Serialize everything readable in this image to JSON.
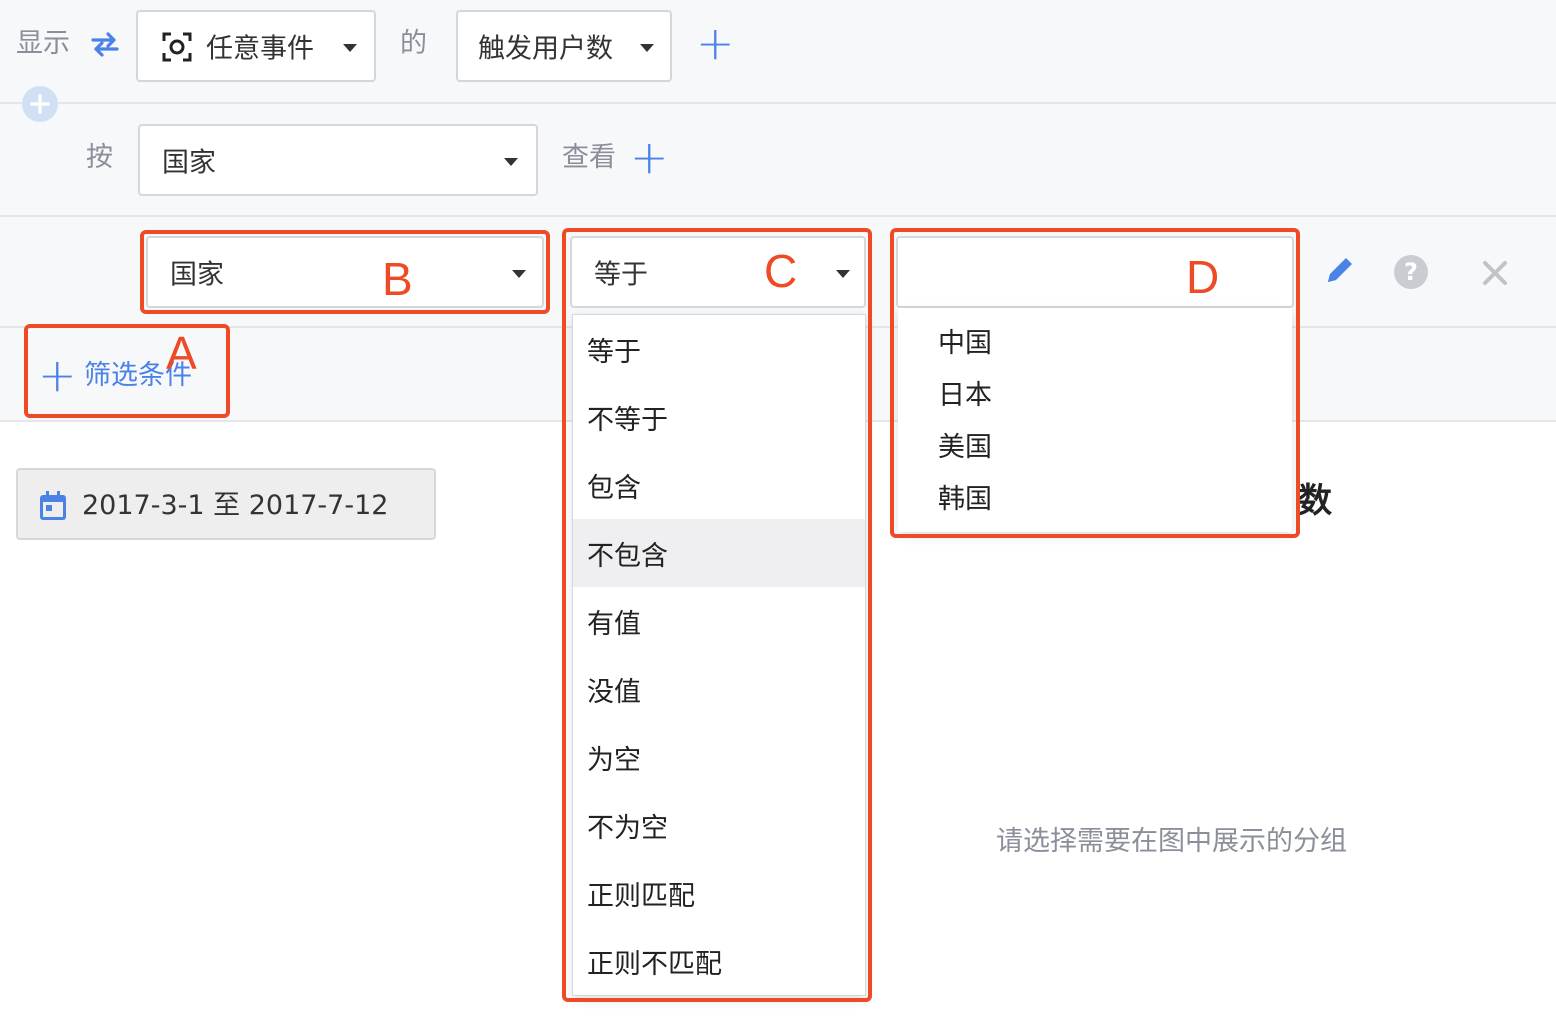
{
  "row1": {
    "show_label": "显示",
    "event_select": "任意事件",
    "of_label": "的",
    "metric_select": "触发用户数"
  },
  "row2": {
    "by_label": "按",
    "group_select": "国家",
    "view_label": "查看"
  },
  "filter": {
    "property_select": "国家",
    "operator_select": "等于",
    "value_input": "",
    "add_filter_label": "筛选条件"
  },
  "annotations": {
    "a": "A",
    "b": "B",
    "c": "C",
    "d": "D"
  },
  "operator_menu": {
    "items": [
      "等于",
      "不等于",
      "包含",
      "不包含",
      "有值",
      "没值",
      "为空",
      "不为空",
      "正则匹配",
      "正则不匹配"
    ],
    "highlighted": "不包含"
  },
  "value_menu": {
    "items": [
      "中国",
      "日本",
      "美国",
      "韩国"
    ]
  },
  "main": {
    "date_range": "2017-3-1 至 2017-7-12",
    "chart_title_fragment": "数",
    "empty_message": "请选择需要在图中展示的分组"
  },
  "colors": {
    "accent": "#4a82e6",
    "annotation": "#ee4a25",
    "band": "#f7f8fa"
  }
}
